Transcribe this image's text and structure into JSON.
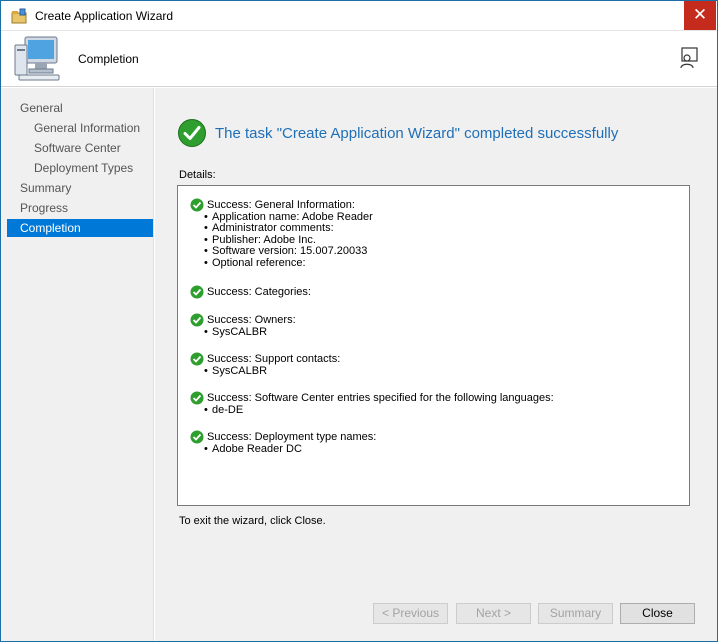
{
  "window": {
    "title": "Create Application Wizard"
  },
  "header": {
    "title": "Completion"
  },
  "sidebar": {
    "items": [
      {
        "label": "General",
        "level": "top",
        "active": false
      },
      {
        "label": "General Information",
        "level": "sub",
        "active": false
      },
      {
        "label": "Software Center",
        "level": "sub",
        "active": false
      },
      {
        "label": "Deployment Types",
        "level": "sub",
        "active": false
      },
      {
        "label": "Summary",
        "level": "top",
        "active": false
      },
      {
        "label": "Progress",
        "level": "top",
        "active": false
      },
      {
        "label": "Completion",
        "level": "top",
        "active": true
      }
    ]
  },
  "main": {
    "heading": "The task \"Create Application Wizard\" completed successfully",
    "details_label": "Details:",
    "details": [
      {
        "head": "Success: General Information:",
        "items": [
          "Application name: Adobe Reader",
          "Administrator comments:",
          "Publisher: Adobe Inc.",
          "Software version: 15.007.20033",
          "Optional reference:"
        ]
      },
      {
        "head": "Success: Categories:",
        "items": []
      },
      {
        "head": "Success: Owners:",
        "items": [
          "SysCALBR"
        ]
      },
      {
        "head": "Success: Support contacts:",
        "items": [
          "SysCALBR"
        ]
      },
      {
        "head": "Success: Software Center entries specified for the following languages:",
        "items": [
          "de-DE"
        ]
      },
      {
        "head": "Success: Deployment type names:",
        "items": [
          "Adobe Reader DC"
        ]
      }
    ],
    "exit_text": "To exit the wizard, click Close."
  },
  "buttons": {
    "previous": "< Previous",
    "next": "Next >",
    "summary": "Summary",
    "close": "Close"
  },
  "colors": {
    "accent": "#0078d7",
    "heading": "#1e6fb8",
    "close_bg": "#c42b1c",
    "success": "#2e9e2e"
  },
  "icons": {
    "title": "wizard-app-icon",
    "header": "computer-icon",
    "help": "help-icon",
    "success": "check-circle-icon"
  }
}
